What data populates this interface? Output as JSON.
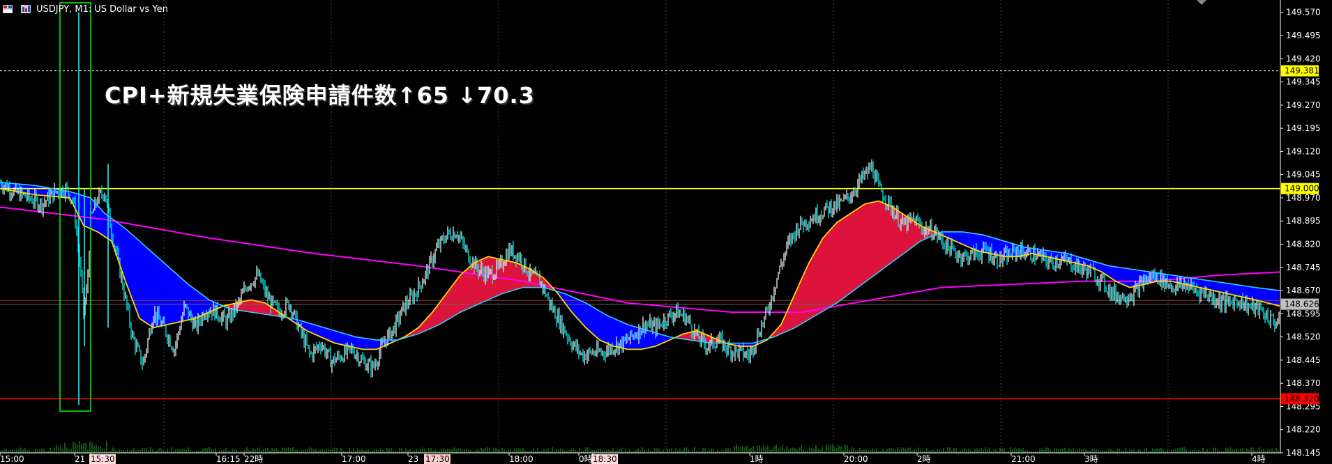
{
  "header": {
    "symbol": "USDJPY, M1:",
    "description": "US Dollar vs Yen"
  },
  "annotation": "CPI+新規失業保険申請件数↑65 ↓70.3",
  "colors": {
    "background": "#000000",
    "candle_up": "#ffffff",
    "candle_down": "#00ffff",
    "ma_fast": "#ffd700",
    "ma_slow": "#33ccff",
    "ma_long": "#ff00ff",
    "cloud_bull": "#dc143c",
    "cloud_bear": "#0000ff",
    "level_yellow": "#ffff00",
    "level_red": "#ff0000",
    "level_white": "#ffffff",
    "level_dark_red": "#aa3333",
    "highlight_box": "#00ff00",
    "grid": "#444444",
    "axis_text": "#ffffff"
  },
  "chart_data": {
    "type": "candlestick",
    "symbol": "USDJPY",
    "timeframe": "M1",
    "ylim": [
      148.145,
      149.61
    ],
    "y_ticks": [
      149.57,
      149.495,
      149.42,
      149.345,
      149.27,
      149.195,
      149.12,
      149.045,
      148.97,
      148.895,
      148.82,
      148.745,
      148.67,
      148.595,
      148.52,
      148.445,
      148.37,
      148.295,
      148.22,
      148.145
    ],
    "x_ticks": [
      {
        "label": "15:00",
        "i": 0
      },
      {
        "label": "21",
        "i": 107
      },
      {
        "label": "15:30",
        "i": 130
      },
      {
        "label": "16:15",
        "i": 310
      },
      {
        "label": "22時",
        "i": 350
      },
      {
        "label": "17:00",
        "i": 490
      },
      {
        "label": "23",
        "i": 585
      },
      {
        "label": "17:30",
        "i": 610
      },
      {
        "label": "18:00",
        "i": 730
      },
      {
        "label": "0時",
        "i": 830
      },
      {
        "label": "18:30",
        "i": 850
      },
      {
        "label": "1時",
        "i": 1075
      },
      {
        "label": "20:00",
        "i": 1210
      },
      {
        "label": "2時",
        "i": 1315
      },
      {
        "label": "21:00",
        "i": 1450
      },
      {
        "label": "3時",
        "i": 1555
      },
      {
        "label": "4時",
        "i": 1795
      }
    ],
    "price_labels": [
      {
        "value": 149.381,
        "label": "149.381",
        "bg": "#ffff00",
        "fg": "#000000",
        "line": "#ffffff",
        "dash": true
      },
      {
        "value": 149.0,
        "label": "149.000",
        "bg": "#ffff00",
        "fg": "#000000",
        "line": "#ffff00",
        "dash": false
      },
      {
        "value": 148.638,
        "label": "",
        "bg": "",
        "fg": "",
        "line": "#aa3333",
        "dash": false
      },
      {
        "value": 148.626,
        "label": "148.626",
        "bg": "#c0c0c0",
        "fg": "#000000",
        "line": "#666666",
        "dash": false
      },
      {
        "value": 148.32,
        "label": "148.320",
        "bg": "#ff0000",
        "fg": "#000000",
        "line": "#ff0000",
        "dash": false
      }
    ],
    "highlight_box": {
      "i_start": 86,
      "i_end": 130,
      "y_top": 149.61,
      "y_bottom": 148.28
    },
    "price_path": [
      [
        0,
        149.02
      ],
      [
        20,
        148.99
      ],
      [
        40,
        148.97
      ],
      [
        60,
        148.95
      ],
      [
        80,
        148.99
      ],
      [
        95,
        149.0
      ],
      [
        105,
        148.96
      ],
      [
        110,
        148.86
      ],
      [
        115,
        148.74
      ],
      [
        120,
        148.6
      ],
      [
        125,
        148.68
      ],
      [
        130,
        148.9
      ],
      [
        140,
        148.97
      ],
      [
        150,
        148.99
      ],
      [
        160,
        148.86
      ],
      [
        175,
        148.7
      ],
      [
        190,
        148.52
      ],
      [
        205,
        148.43
      ],
      [
        220,
        148.6
      ],
      [
        235,
        148.55
      ],
      [
        250,
        148.48
      ],
      [
        265,
        148.62
      ],
      [
        280,
        148.55
      ],
      [
        295,
        148.61
      ],
      [
        310,
        148.6
      ],
      [
        325,
        148.57
      ],
      [
        340,
        148.62
      ],
      [
        355,
        148.69
      ],
      [
        370,
        148.72
      ],
      [
        385,
        148.64
      ],
      [
        400,
        148.6
      ],
      [
        415,
        148.63
      ],
      [
        430,
        148.54
      ],
      [
        445,
        148.46
      ],
      [
        460,
        148.5
      ],
      [
        475,
        148.44
      ],
      [
        490,
        148.46
      ],
      [
        505,
        148.48
      ],
      [
        520,
        148.44
      ],
      [
        535,
        148.42
      ],
      [
        550,
        148.5
      ],
      [
        565,
        148.55
      ],
      [
        580,
        148.62
      ],
      [
        595,
        148.66
      ],
      [
        610,
        148.72
      ],
      [
        625,
        148.8
      ],
      [
        640,
        148.85
      ],
      [
        655,
        148.86
      ],
      [
        670,
        148.79
      ],
      [
        685,
        148.74
      ],
      [
        700,
        148.72
      ],
      [
        715,
        148.74
      ],
      [
        730,
        148.8
      ],
      [
        745,
        148.78
      ],
      [
        760,
        148.72
      ],
      [
        775,
        148.7
      ],
      [
        790,
        148.62
      ],
      [
        805,
        148.56
      ],
      [
        820,
        148.5
      ],
      [
        835,
        148.46
      ],
      [
        850,
        148.47
      ],
      [
        865,
        148.47
      ],
      [
        880,
        148.49
      ],
      [
        895,
        148.5
      ],
      [
        910,
        148.53
      ],
      [
        925,
        148.56
      ],
      [
        940,
        148.55
      ],
      [
        955,
        148.58
      ],
      [
        970,
        148.6
      ],
      [
        985,
        148.58
      ],
      [
        1000,
        148.52
      ],
      [
        1015,
        148.49
      ],
      [
        1030,
        148.51
      ],
      [
        1045,
        148.48
      ],
      [
        1060,
        148.47
      ],
      [
        1075,
        148.46
      ],
      [
        1085,
        148.52
      ],
      [
        1100,
        148.6
      ],
      [
        1115,
        148.72
      ],
      [
        1130,
        148.82
      ],
      [
        1145,
        148.88
      ],
      [
        1160,
        148.9
      ],
      [
        1175,
        148.92
      ],
      [
        1190,
        148.94
      ],
      [
        1205,
        148.95
      ],
      [
        1220,
        148.98
      ],
      [
        1235,
        149.03
      ],
      [
        1250,
        149.07
      ],
      [
        1260,
        149.0
      ],
      [
        1270,
        148.97
      ],
      [
        1280,
        148.93
      ],
      [
        1295,
        148.88
      ],
      [
        1310,
        148.9
      ],
      [
        1325,
        148.87
      ],
      [
        1340,
        148.86
      ],
      [
        1355,
        148.82
      ],
      [
        1370,
        148.79
      ],
      [
        1385,
        148.78
      ],
      [
        1400,
        148.79
      ],
      [
        1415,
        148.8
      ],
      [
        1430,
        148.77
      ],
      [
        1445,
        148.78
      ],
      [
        1460,
        148.8
      ],
      [
        1475,
        148.79
      ],
      [
        1490,
        148.78
      ],
      [
        1505,
        148.76
      ],
      [
        1520,
        148.77
      ],
      [
        1535,
        148.76
      ],
      [
        1550,
        148.74
      ],
      [
        1565,
        148.73
      ],
      [
        1580,
        148.7
      ],
      [
        1595,
        148.66
      ],
      [
        1610,
        148.65
      ],
      [
        1625,
        148.66
      ],
      [
        1640,
        148.7
      ],
      [
        1655,
        148.72
      ],
      [
        1670,
        148.7
      ],
      [
        1685,
        148.68
      ],
      [
        1700,
        148.69
      ],
      [
        1715,
        148.67
      ],
      [
        1730,
        148.66
      ],
      [
        1745,
        148.64
      ],
      [
        1760,
        148.63
      ],
      [
        1775,
        148.64
      ],
      [
        1790,
        148.62
      ],
      [
        1805,
        148.61
      ],
      [
        1820,
        148.58
      ],
      [
        1835,
        148.56
      ]
    ],
    "spikes": [
      {
        "i": 113,
        "high": 149.57,
        "low": 148.3
      },
      {
        "i": 121,
        "high": 149.0,
        "low": 148.49
      },
      {
        "i": 155,
        "high": 149.08,
        "low": 148.55
      }
    ],
    "ma_long": [
      [
        0,
        148.94
      ],
      [
        150,
        148.9
      ],
      [
        300,
        148.84
      ],
      [
        450,
        148.79
      ],
      [
        600,
        148.75
      ],
      [
        750,
        148.7
      ],
      [
        900,
        148.63
      ],
      [
        1050,
        148.6
      ],
      [
        1150,
        148.6
      ],
      [
        1250,
        148.64
      ],
      [
        1350,
        148.68
      ],
      [
        1450,
        148.69
      ],
      [
        1550,
        148.7
      ],
      [
        1650,
        148.7
      ],
      [
        1750,
        148.72
      ],
      [
        1835,
        148.73
      ]
    ],
    "ma_fast": [
      [
        0,
        149.0
      ],
      [
        50,
        148.98
      ],
      [
        100,
        148.97
      ],
      [
        120,
        148.88
      ],
      [
        140,
        148.86
      ],
      [
        160,
        148.83
      ],
      [
        180,
        148.7
      ],
      [
        200,
        148.58
      ],
      [
        220,
        148.55
      ],
      [
        240,
        148.56
      ],
      [
        260,
        148.57
      ],
      [
        280,
        148.58
      ],
      [
        300,
        148.6
      ],
      [
        320,
        148.62
      ],
      [
        340,
        148.63
      ],
      [
        360,
        148.64
      ],
      [
        380,
        148.63
      ],
      [
        400,
        148.6
      ],
      [
        420,
        148.57
      ],
      [
        440,
        148.54
      ],
      [
        460,
        148.52
      ],
      [
        480,
        148.5
      ],
      [
        500,
        148.49
      ],
      [
        520,
        148.48
      ],
      [
        540,
        148.48
      ],
      [
        560,
        148.5
      ],
      [
        580,
        148.52
      ],
      [
        600,
        148.55
      ],
      [
        620,
        148.6
      ],
      [
        640,
        148.66
      ],
      [
        660,
        148.72
      ],
      [
        680,
        148.76
      ],
      [
        700,
        148.78
      ],
      [
        720,
        148.77
      ],
      [
        740,
        148.76
      ],
      [
        760,
        148.74
      ],
      [
        780,
        148.71
      ],
      [
        800,
        148.66
      ],
      [
        820,
        148.6
      ],
      [
        840,
        148.55
      ],
      [
        860,
        148.51
      ],
      [
        880,
        148.49
      ],
      [
        900,
        148.48
      ],
      [
        920,
        148.48
      ],
      [
        940,
        148.49
      ],
      [
        960,
        148.51
      ],
      [
        980,
        148.53
      ],
      [
        1000,
        148.54
      ],
      [
        1020,
        148.52
      ],
      [
        1040,
        148.5
      ],
      [
        1060,
        148.49
      ],
      [
        1080,
        148.49
      ],
      [
        1100,
        148.51
      ],
      [
        1120,
        148.56
      ],
      [
        1140,
        148.66
      ],
      [
        1160,
        148.76
      ],
      [
        1180,
        148.84
      ],
      [
        1200,
        148.89
      ],
      [
        1220,
        148.92
      ],
      [
        1240,
        148.95
      ],
      [
        1260,
        148.96
      ],
      [
        1280,
        148.94
      ],
      [
        1300,
        148.91
      ],
      [
        1320,
        148.88
      ],
      [
        1340,
        148.86
      ],
      [
        1360,
        148.84
      ],
      [
        1380,
        148.82
      ],
      [
        1400,
        148.8
      ],
      [
        1420,
        148.79
      ],
      [
        1440,
        148.78
      ],
      [
        1460,
        148.78
      ],
      [
        1480,
        148.79
      ],
      [
        1500,
        148.78
      ],
      [
        1520,
        148.77
      ],
      [
        1540,
        148.76
      ],
      [
        1560,
        148.75
      ],
      [
        1580,
        148.73
      ],
      [
        1600,
        148.7
      ],
      [
        1620,
        148.68
      ],
      [
        1640,
        148.69
      ],
      [
        1660,
        148.7
      ],
      [
        1680,
        148.7
      ],
      [
        1700,
        148.69
      ],
      [
        1720,
        148.68
      ],
      [
        1740,
        148.67
      ],
      [
        1760,
        148.66
      ],
      [
        1780,
        148.65
      ],
      [
        1800,
        148.64
      ],
      [
        1835,
        148.62
      ]
    ],
    "ma_slow": [
      [
        0,
        149.02
      ],
      [
        50,
        149.01
      ],
      [
        100,
        148.99
      ],
      [
        130,
        148.97
      ],
      [
        150,
        148.92
      ],
      [
        180,
        148.87
      ],
      [
        210,
        148.81
      ],
      [
        240,
        148.75
      ],
      [
        270,
        148.69
      ],
      [
        300,
        148.64
      ],
      [
        330,
        148.61
      ],
      [
        360,
        148.6
      ],
      [
        390,
        148.59
      ],
      [
        420,
        148.58
      ],
      [
        450,
        148.56
      ],
      [
        480,
        148.54
      ],
      [
        510,
        148.52
      ],
      [
        540,
        148.51
      ],
      [
        570,
        148.51
      ],
      [
        600,
        148.53
      ],
      [
        630,
        148.56
      ],
      [
        660,
        148.6
      ],
      [
        690,
        148.63
      ],
      [
        720,
        148.66
      ],
      [
        750,
        148.68
      ],
      [
        780,
        148.68
      ],
      [
        810,
        148.66
      ],
      [
        840,
        148.63
      ],
      [
        870,
        148.59
      ],
      [
        900,
        148.56
      ],
      [
        930,
        148.54
      ],
      [
        960,
        148.52
      ],
      [
        990,
        148.51
      ],
      [
        1020,
        148.5
      ],
      [
        1050,
        148.5
      ],
      [
        1080,
        148.5
      ],
      [
        1110,
        148.52
      ],
      [
        1140,
        148.55
      ],
      [
        1170,
        148.59
      ],
      [
        1200,
        148.63
      ],
      [
        1230,
        148.68
      ],
      [
        1260,
        148.73
      ],
      [
        1290,
        148.78
      ],
      [
        1320,
        148.83
      ],
      [
        1350,
        148.86
      ],
      [
        1380,
        148.86
      ],
      [
        1410,
        148.85
      ],
      [
        1440,
        148.83
      ],
      [
        1470,
        148.81
      ],
      [
        1500,
        148.8
      ],
      [
        1530,
        148.79
      ],
      [
        1560,
        148.77
      ],
      [
        1590,
        148.75
      ],
      [
        1620,
        148.74
      ],
      [
        1650,
        148.73
      ],
      [
        1680,
        148.72
      ],
      [
        1710,
        148.71
      ],
      [
        1740,
        148.7
      ],
      [
        1770,
        148.69
      ],
      [
        1800,
        148.68
      ],
      [
        1835,
        148.67
      ]
    ]
  }
}
